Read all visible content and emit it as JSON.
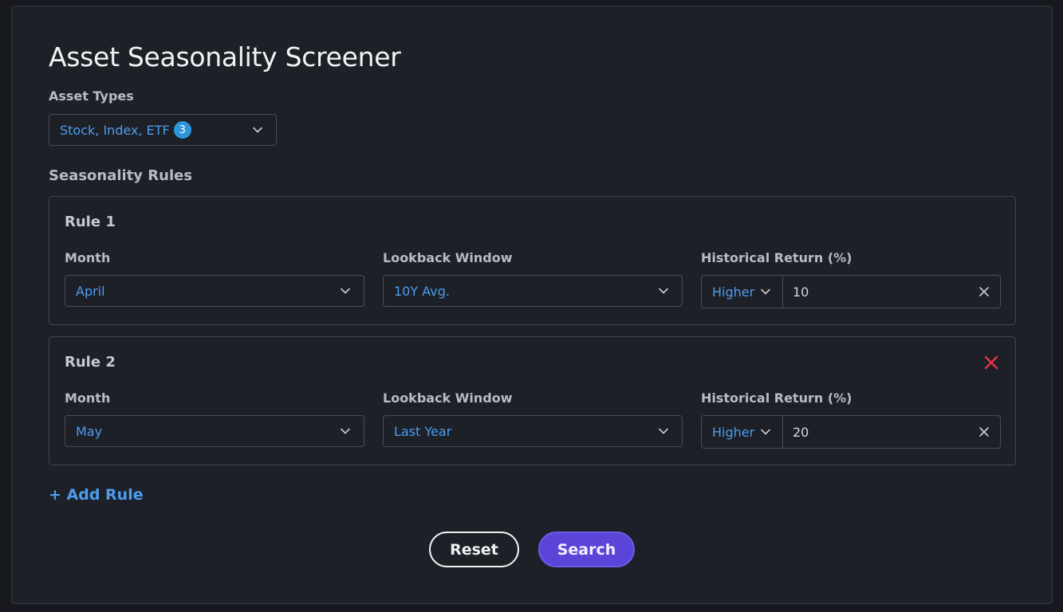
{
  "page": {
    "title": "Asset Seasonality Screener"
  },
  "asset_types": {
    "label": "Asset Types",
    "value": "Stock, Index, ETF",
    "count": "3"
  },
  "rules_section": {
    "label": "Seasonality Rules",
    "add_rule_label": "+ Add Rule"
  },
  "rules": [
    {
      "title": "Rule 1",
      "month_label": "Month",
      "month_value": "April",
      "lookback_label": "Lookback Window",
      "lookback_value": "10Y Avg.",
      "return_label": "Historical Return (%)",
      "operator_value": "Higher",
      "return_value": "10"
    },
    {
      "title": "Rule 2",
      "month_label": "Month",
      "month_value": "May",
      "lookback_label": "Lookback Window",
      "lookback_value": "Last Year",
      "return_label": "Historical Return (%)",
      "operator_value": "Higher",
      "return_value": "20"
    }
  ],
  "actions": {
    "reset_label": "Reset",
    "search_label": "Search"
  },
  "colors": {
    "background": "#1d2027",
    "accent_blue": "#4c9df0",
    "primary_purple": "#5b45d9",
    "danger_red": "#e8334f",
    "badge_blue": "#2c96d8"
  },
  "icons": {
    "dropdown": "chevron-down-icon",
    "clear": "close-icon",
    "remove_rule": "remove-rule-icon"
  }
}
